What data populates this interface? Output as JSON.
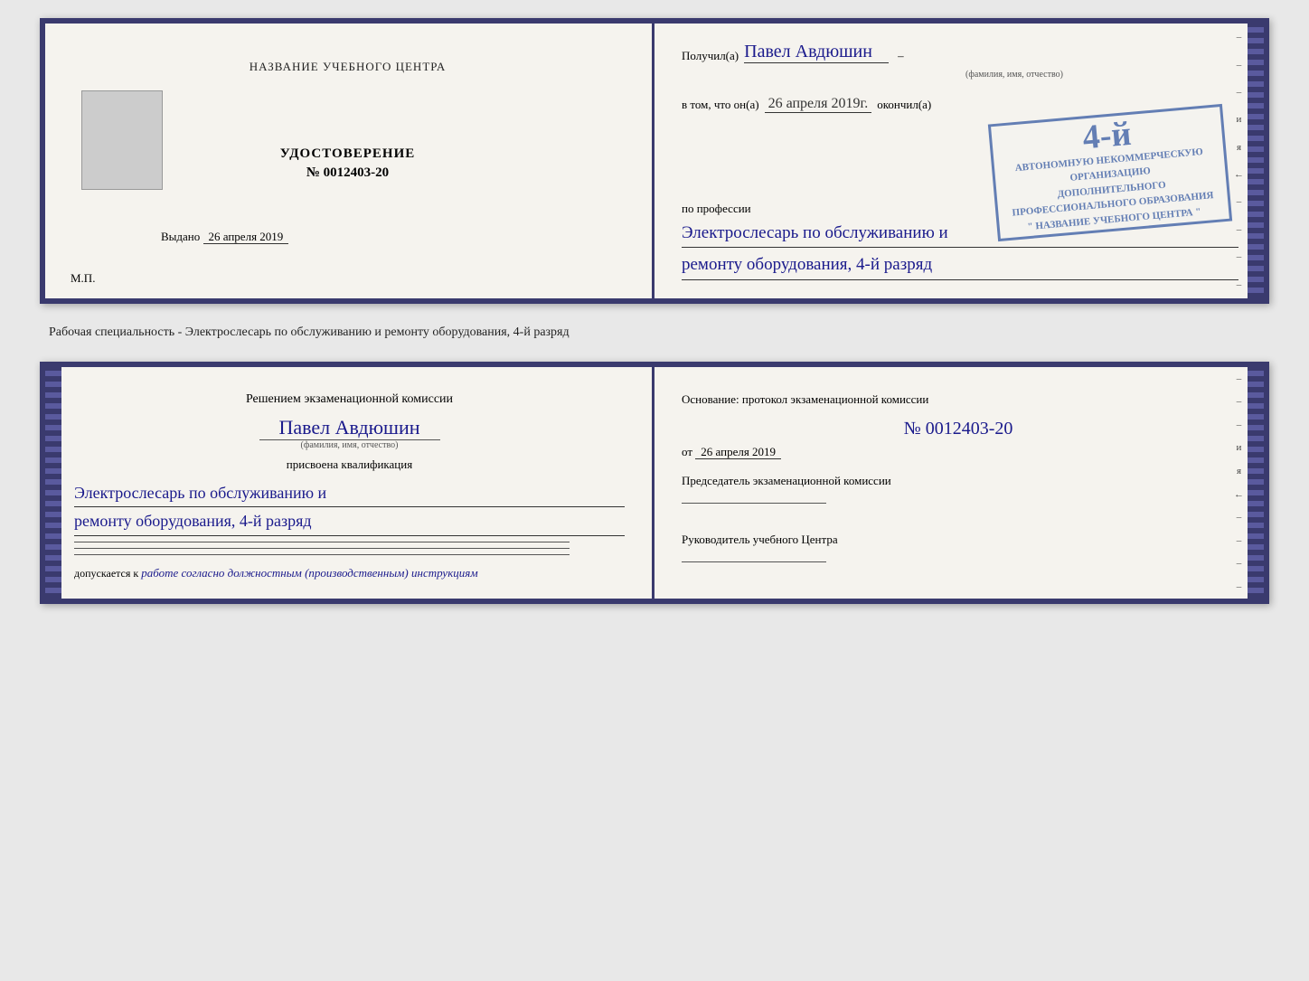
{
  "top_document": {
    "left_page": {
      "institution_name": "НАЗВАНИЕ УЧЕБНОГО ЦЕНТРА",
      "udostoverenie_title": "УДОСТОВЕРЕНИЕ",
      "udostoverenie_number": "№ 0012403-20",
      "vydano_label": "Выдано",
      "vydano_date": "26 апреля 2019",
      "mp_label": "М.П."
    },
    "right_page": {
      "recipient_label": "Получил(a)",
      "recipient_name": "Павел Авдюшин",
      "fio_caption": "(фамилия, имя, отчество)",
      "vtom_label": "в том, что он(а)",
      "vtom_date": "26 апреля 2019г.",
      "okonchil_label": "окончил(а)",
      "stamp_line1": "АВТОНОМНУЮ НЕКОММЕРЧЕСКУЮ ОРГАНИЗАЦИЮ",
      "stamp_line2": "ДОПОЛНИТЕЛЬНОГО ПРОФЕССИОНАЛЬНОГО ОБРАЗОВАНИЯ",
      "stamp_line3": "\" НАЗВАНИЕ УЧЕБНОГО ЦЕНТРА \"",
      "stamp_grade": "4-й",
      "profession_label": "по профессии",
      "profession_line1": "Электрослесарь по обслуживанию и",
      "profession_line2": "ремонту оборудования, 4-й разряд"
    }
  },
  "middle_text": "Рабочая специальность - Электрослесарь по обслуживанию и ремонту оборудования, 4-й разряд",
  "bottom_document": {
    "left_page": {
      "komissia_text": "Решением экзаменационной комиссии",
      "person_name": "Павел Авдюшин",
      "fio_caption": "(фамилия, имя, отчество)",
      "prisvoena_text": "присвоена квалификация",
      "kvalif_line1": "Электрослесарь по обслуживанию и",
      "kvalif_line2": "ремонту оборудования, 4-й разряд",
      "dopuskaetsya_label": "допускается к",
      "dopuskaetsya_value": "работе согласно должностным (производственным) инструкциям"
    },
    "right_page": {
      "osnov_label": "Основание: протокол экзаменационной комиссии",
      "number": "№  0012403-20",
      "date_label": "от",
      "date_value": "26 апреля 2019",
      "predsedatel_label": "Председатель экзаменационной комиссии",
      "rukovoditel_label": "Руководитель учебного Центра"
    }
  },
  "side_marks": {
    "top": [
      "–",
      "–",
      "–",
      "и",
      "я",
      "←",
      "–",
      "–",
      "–",
      "–"
    ],
    "bottom": [
      "–",
      "–",
      "–",
      "и",
      "я",
      "←",
      "–",
      "–",
      "–",
      "–"
    ]
  }
}
